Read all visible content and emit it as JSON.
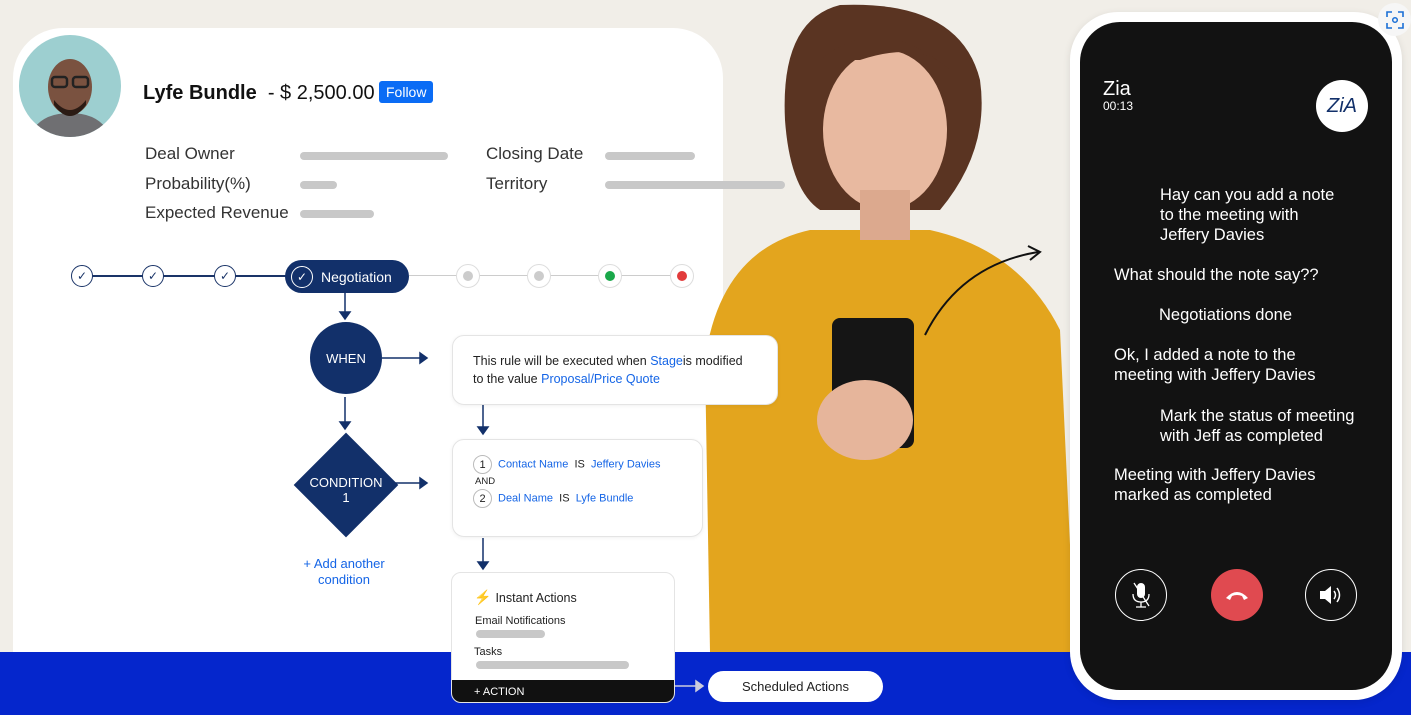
{
  "deal": {
    "name": "Lyfe Bundle",
    "amount": "- $ 2,500.00",
    "follow_label": "Follow"
  },
  "fields": {
    "deal_owner": "Deal Owner",
    "probability": "Probability(%)",
    "expected_revenue": "Expected Revenue",
    "closing_date": "Closing Date",
    "territory": "Territory"
  },
  "pipeline": {
    "current_stage": "Negotiation",
    "status_colors": {
      "won": "#1aa84a",
      "lost": "#e23b3b"
    }
  },
  "rule": {
    "when_label": "WHEN",
    "when_text_1": "This rule will be executed when ",
    "when_field": "Stage",
    "when_text_2": "is modified",
    "when_text_3": "to the value ",
    "when_value": "Proposal/Price Quote",
    "condition_label": "CONDITION",
    "condition_number": "1",
    "conditions": [
      {
        "n": "1",
        "field": "Contact Name",
        "op": "IS",
        "value": "Jeffery Davies"
      },
      {
        "n": "2",
        "field": "Deal Name",
        "op": "IS",
        "value": "Lyfe Bundle"
      }
    ],
    "and_label": "AND",
    "add_condition": "+ Add another condition",
    "instant_actions": "Instant Actions",
    "email_notifications": "Email Notifications",
    "tasks": "Tasks",
    "add_action": "+ ACTION",
    "scheduled_actions": "Scheduled Actions"
  },
  "call": {
    "caller": "Zia",
    "duration": "00:13",
    "messages": [
      {
        "from": "user",
        "text": "Hay can you add a note to the meeting with Jeffery Davies"
      },
      {
        "from": "zia",
        "text": "What should the note say??"
      },
      {
        "from": "user",
        "text": "Negotiations done"
      },
      {
        "from": "zia",
        "text": "Ok, I added a note to the meeting with Jeffery Davies"
      },
      {
        "from": "user",
        "text": "Mark the status of meeting with Jeff as completed"
      },
      {
        "from": "zia",
        "text": "Meeting with Jeffery Davies marked as completed"
      }
    ],
    "end_color": "#e04a50"
  },
  "colors": {
    "navy": "#12306a",
    "band": "#0526cc",
    "link": "#1565e6"
  }
}
